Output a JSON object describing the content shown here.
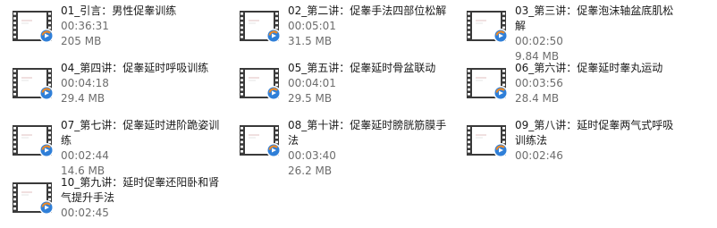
{
  "colors": {
    "name_text": "#1a1a1a",
    "meta_text": "#6d6d6d",
    "film_frame": "#3a3a3a",
    "film_hole": "#ffffff",
    "play_badge_blue": "#2f7fd8",
    "play_badge_orange": "#f08a24"
  },
  "files": [
    {
      "name": "01_引言：男性促睾训练",
      "duration": "00:36:31",
      "size": "205 MB",
      "icon": "video-file-icon"
    },
    {
      "name": "02_第二讲：促睾手法四部位松解",
      "duration": "00:05:01",
      "size": "31.5 MB",
      "icon": "video-file-icon"
    },
    {
      "name": "03_第三讲：促睾泡沫轴盆底肌松解",
      "duration": "00:02:50",
      "size": "9.84 MB",
      "icon": "video-file-icon"
    },
    {
      "name": "04_第四讲：促睾延时呼吸训练",
      "duration": "00:04:18",
      "size": "29.4 MB",
      "icon": "video-file-icon"
    },
    {
      "name": "05_第五讲：促睾延时骨盆联动",
      "duration": "00:04:01",
      "size": "29.5 MB",
      "icon": "video-file-icon"
    },
    {
      "name": "06_第六讲：促睾延时睾丸运动",
      "duration": "00:03:56",
      "size": "28.4 MB",
      "icon": "video-file-icon"
    },
    {
      "name": "07_第七讲：促睾延时进阶跪姿训练",
      "duration": "00:02:44",
      "size": "14.6 MB",
      "icon": "video-file-icon"
    },
    {
      "name": "08_第十讲：促睾延时膀胱筋膜手法",
      "duration": "00:03:40",
      "size": "26.2 MB",
      "icon": "video-file-icon"
    },
    {
      "name": "09_第八讲：延时促睾两气式呼吸训练法",
      "duration": "00:02:46",
      "size": "",
      "icon": "video-file-icon"
    },
    {
      "name": "10_第九讲：延时促睾还阳卧和肾气提升手法",
      "duration": "00:02:45",
      "size": "",
      "icon": "video-file-icon"
    }
  ]
}
